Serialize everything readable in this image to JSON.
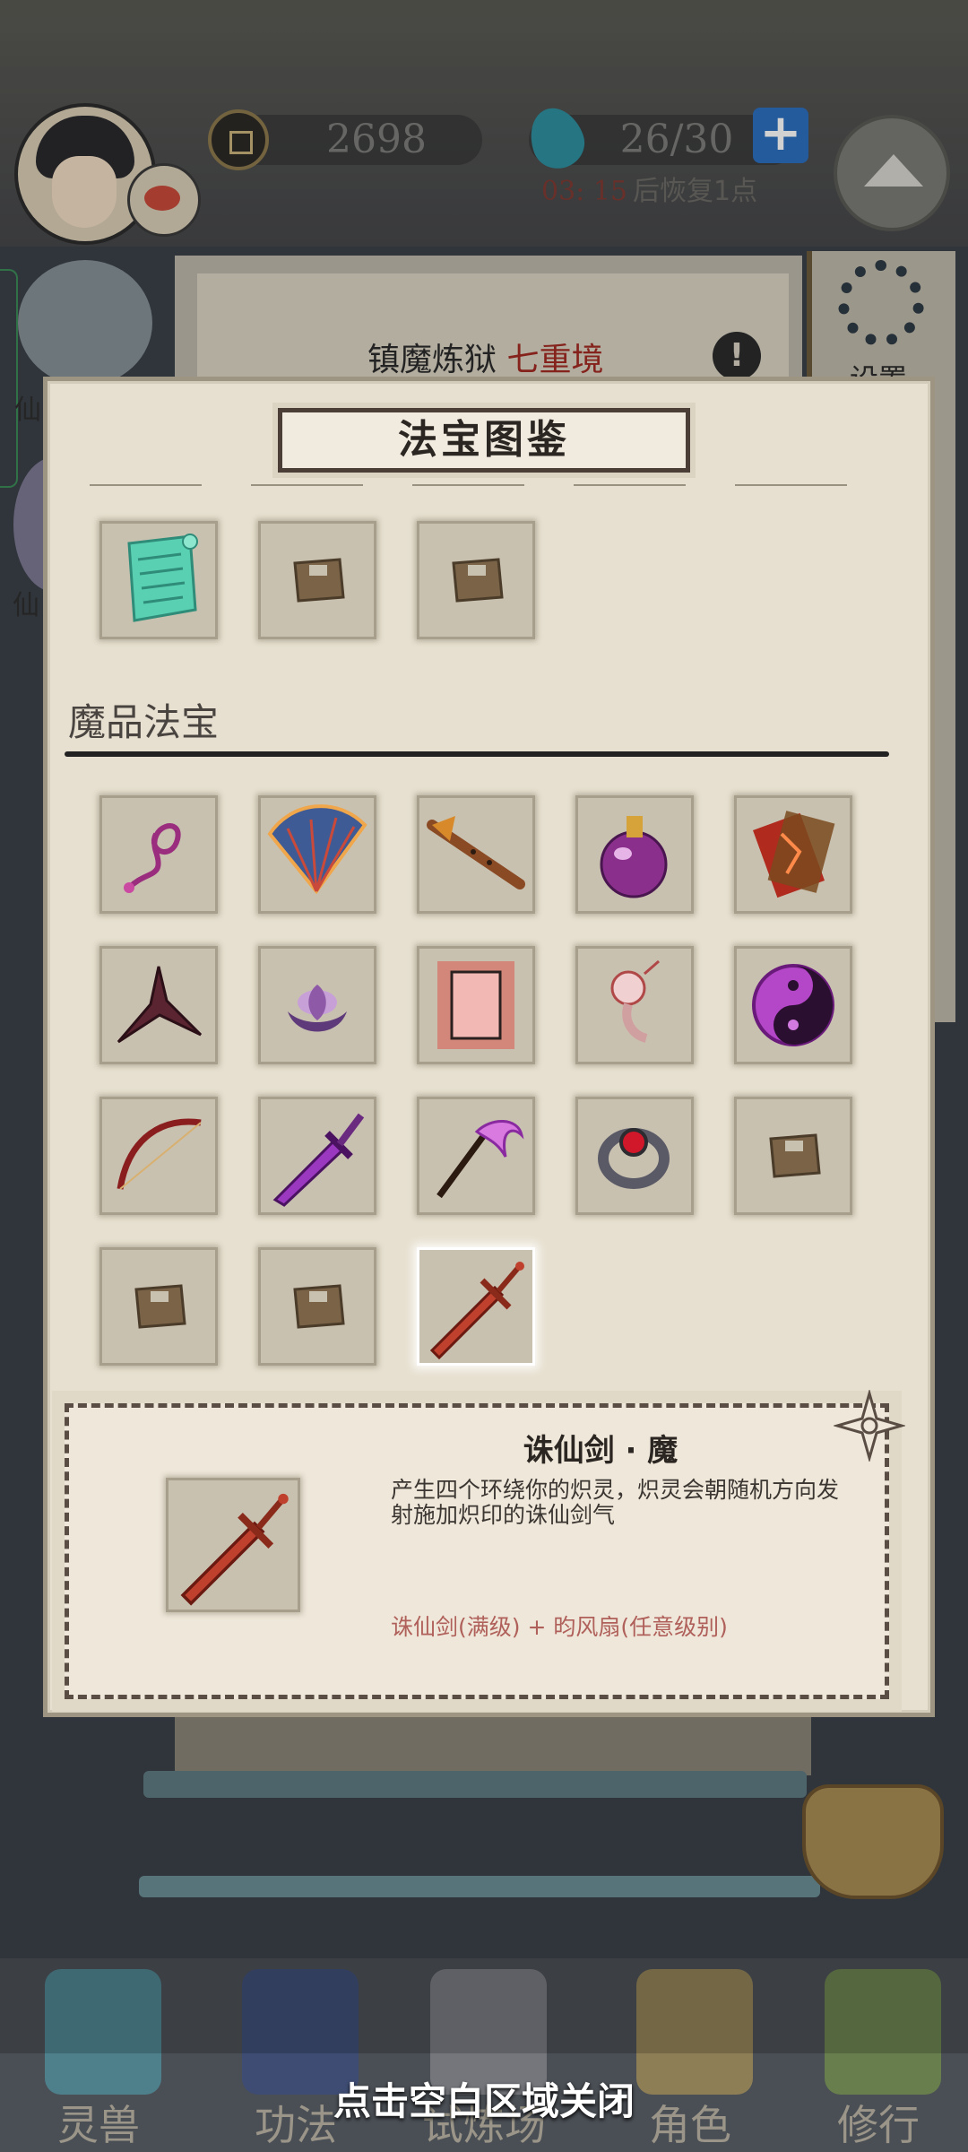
{
  "hud": {
    "coins": "2698",
    "stamina": "26/30",
    "recover_time": "03: 15",
    "recover_suffix": "后恢复1点",
    "plus_label": "+"
  },
  "background": {
    "realm_title": "镇魔炼狱",
    "realm_level": "七重境",
    "info_label": "!",
    "settings_label": "设置",
    "left_label_1": "仙",
    "left_label_2": "仙"
  },
  "modal": {
    "title": "法宝图鉴",
    "top_row": [
      {
        "name": "scroll-icon",
        "locked": false
      },
      {
        "name": "locked-slot",
        "locked": true
      },
      {
        "name": "locked-slot",
        "locked": true
      }
    ],
    "section_title": "魔品法宝",
    "items": [
      {
        "name": "whip-icon",
        "locked": false
      },
      {
        "name": "fan-icon",
        "locked": false
      },
      {
        "name": "flute-icon",
        "locked": false
      },
      {
        "name": "potion-gourd-icon",
        "locked": false
      },
      {
        "name": "talisman-icon",
        "locked": false
      },
      {
        "name": "shuriken-icon",
        "locked": false
      },
      {
        "name": "lotus-icon",
        "locked": false
      },
      {
        "name": "glowing-tablet-icon",
        "locked": false
      },
      {
        "name": "incense-pendant-icon",
        "locked": false
      },
      {
        "name": "yin-yang-icon",
        "locked": false
      },
      {
        "name": "bow-icon",
        "locked": false
      },
      {
        "name": "purple-sword-icon",
        "locked": false
      },
      {
        "name": "scythe-icon",
        "locked": false
      },
      {
        "name": "ring-icon",
        "locked": false
      },
      {
        "name": "locked-slot",
        "locked": true
      },
      {
        "name": "locked-slot",
        "locked": true
      },
      {
        "name": "locked-slot",
        "locked": true
      },
      {
        "name": "zhuxian-sword-icon",
        "locked": false,
        "selected": true
      }
    ]
  },
  "detail": {
    "name": "诛仙剑 · 魔",
    "description": "产生四个环绕你的炽灵，炽灵会朝随机方向发射施加炽印的诛仙剑气",
    "recipe": "诛仙剑(满级) + 昀风扇(任意级别)"
  },
  "nav": {
    "items": [
      "灵兽",
      "功法",
      "试炼场",
      "角色",
      "修行"
    ]
  },
  "close_hint": "点击空白区域关闭",
  "colors": {
    "panel": "#e7e0d0",
    "slot": "#c9c1b0",
    "recipe": "#b0605a",
    "accent_red": "#a12a22"
  }
}
